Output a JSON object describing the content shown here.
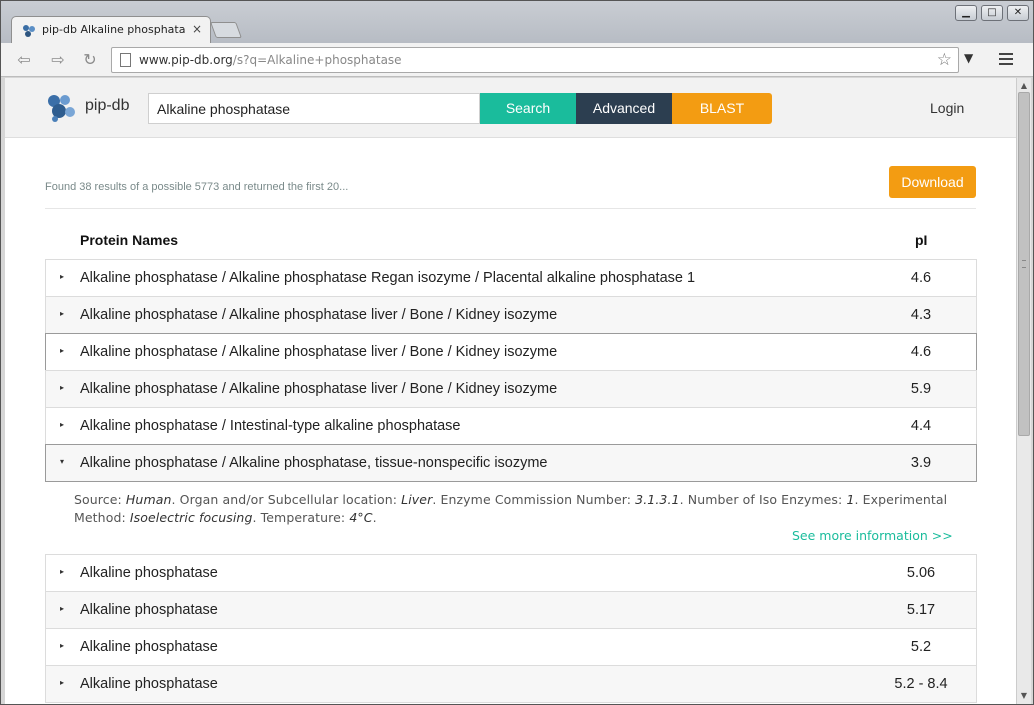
{
  "browser": {
    "tab_title": "pip-db Alkaline phosphata",
    "tab_close": "×",
    "url_host": "www.pip-db.org",
    "url_rest": "/s?q=Alkaline+phosphatase",
    "window_minimize": "▁",
    "window_maximize": "□",
    "window_close": "✕"
  },
  "header": {
    "logo": "pip-db",
    "search_value": "Alkaline phosphatase",
    "search_label": "Search",
    "advanced_label": "Advanced",
    "blast_label": "BLAST",
    "login_label": "Login"
  },
  "results": {
    "summary": "Found 38 results of a possible 5773 and returned the first 20...",
    "download_label": "Download",
    "col_name": "Protein Names",
    "col_pi": "pI",
    "rows": [
      {
        "name": "Alkaline phosphatase / Alkaline phosphatase Regan isozyme / Placental alkaline phosphatase 1",
        "pi": "4.6"
      },
      {
        "name": "Alkaline phosphatase / Alkaline phosphatase liver / Bone / Kidney isozyme",
        "pi": "4.3"
      },
      {
        "name": "Alkaline phosphatase / Alkaline phosphatase liver / Bone / Kidney isozyme",
        "pi": "4.6"
      },
      {
        "name": "Alkaline phosphatase / Alkaline phosphatase liver / Bone / Kidney isozyme",
        "pi": "5.9"
      },
      {
        "name": "Alkaline phosphatase / Intestinal-type alkaline phosphatase",
        "pi": "4.4"
      },
      {
        "name": "Alkaline phosphatase / Alkaline phosphatase, tissue-nonspecific isozyme",
        "pi": "3.9"
      },
      {
        "name": "Alkaline phosphatase",
        "pi": "5.06"
      },
      {
        "name": "Alkaline phosphatase",
        "pi": "5.17"
      },
      {
        "name": "Alkaline phosphatase",
        "pi": "5.2"
      },
      {
        "name": "Alkaline phosphatase",
        "pi": "5.2 - 8.4"
      }
    ],
    "detail": {
      "source_label": "Source:",
      "source": "Human",
      "location_label": "Organ and/or Subcellular location:",
      "location": "Liver",
      "ec_label": "Enzyme Commission Number:",
      "ec": "3.1.3.1",
      "iso_label": "Number of Iso Enzymes:",
      "iso": "1",
      "method_label": "Experimental Method:",
      "method": "Isoelectric focusing",
      "temp_label": "Temperature:",
      "temp": "4°C",
      "more_link": "See more information >>"
    }
  },
  "icons": {
    "collapsed_arrow": "▸",
    "expanded_arrow": "▾",
    "back": "back-icon",
    "forward": "forward-icon",
    "reload": "reload-icon",
    "star": "star-icon",
    "menu": "menu-icon"
  },
  "colors": {
    "search": "#1abc9c",
    "advanced": "#2c3e50",
    "blast": "#f39c12",
    "link": "#1abc9c"
  }
}
